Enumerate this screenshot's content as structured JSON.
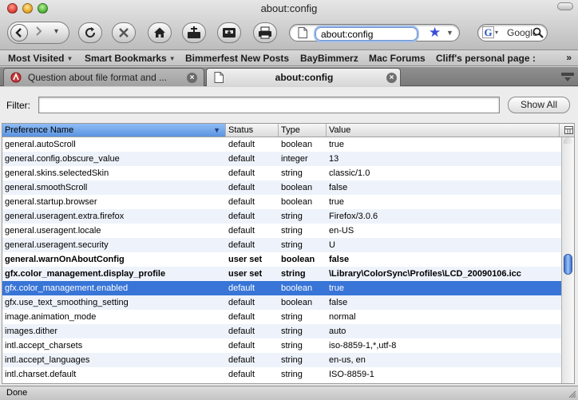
{
  "window": {
    "title": "about:config"
  },
  "toolbar": {
    "url_value": "about:config",
    "search_value": "Google"
  },
  "bookmarks": [
    {
      "label": "Most Visited",
      "folder": true
    },
    {
      "label": "Smart Bookmarks",
      "folder": true
    },
    {
      "label": "Bimmerfest New Posts",
      "folder": false
    },
    {
      "label": "BayBimmerz",
      "folder": false
    },
    {
      "label": "Mac Forums",
      "folder": false
    },
    {
      "label": "Cliff's personal page :",
      "folder": false
    }
  ],
  "bookmarks_overflow": "»",
  "tabs": [
    {
      "label": "Question about file format and ...",
      "active": false
    },
    {
      "label": "about:config",
      "active": true
    }
  ],
  "filter": {
    "label": "Filter:",
    "value": "",
    "show_all_label": "Show All"
  },
  "columns": {
    "name": "Preference Name",
    "status": "Status",
    "type": "Type",
    "value": "Value"
  },
  "rows": [
    {
      "name": "general.autoScroll",
      "status": "default",
      "type": "boolean",
      "value": "true"
    },
    {
      "name": "general.config.obscure_value",
      "status": "default",
      "type": "integer",
      "value": "13"
    },
    {
      "name": "general.skins.selectedSkin",
      "status": "default",
      "type": "string",
      "value": "classic/1.0"
    },
    {
      "name": "general.smoothScroll",
      "status": "default",
      "type": "boolean",
      "value": "false"
    },
    {
      "name": "general.startup.browser",
      "status": "default",
      "type": "boolean",
      "value": "true"
    },
    {
      "name": "general.useragent.extra.firefox",
      "status": "default",
      "type": "string",
      "value": "Firefox/3.0.6"
    },
    {
      "name": "general.useragent.locale",
      "status": "default",
      "type": "string",
      "value": "en-US"
    },
    {
      "name": "general.useragent.security",
      "status": "default",
      "type": "string",
      "value": "U"
    },
    {
      "name": "general.warnOnAboutConfig",
      "status": "user set",
      "type": "boolean",
      "value": "false",
      "bold": true
    },
    {
      "name": "gfx.color_management.display_profile",
      "status": "user set",
      "type": "string",
      "value": "\\Library\\ColorSync\\Profiles\\LCD_20090106.icc",
      "bold": true
    },
    {
      "name": "gfx.color_management.enabled",
      "status": "default",
      "type": "boolean",
      "value": "true",
      "selected": true
    },
    {
      "name": "gfx.use_text_smoothing_setting",
      "status": "default",
      "type": "boolean",
      "value": "false"
    },
    {
      "name": "image.animation_mode",
      "status": "default",
      "type": "string",
      "value": "normal"
    },
    {
      "name": "images.dither",
      "status": "default",
      "type": "string",
      "value": "auto"
    },
    {
      "name": "intl.accept_charsets",
      "status": "default",
      "type": "string",
      "value": "iso-8859-1,*,utf-8"
    },
    {
      "name": "intl.accept_languages",
      "status": "default",
      "type": "string",
      "value": "en-us, en"
    },
    {
      "name": "intl.charset.default",
      "status": "default",
      "type": "string",
      "value": "ISO-8859-1"
    }
  ],
  "status_bar": {
    "text": "Done"
  },
  "colors": {
    "selection": "#3875d7",
    "header_sorted": "#5b93e0",
    "alt_row": "#eef3fb"
  }
}
